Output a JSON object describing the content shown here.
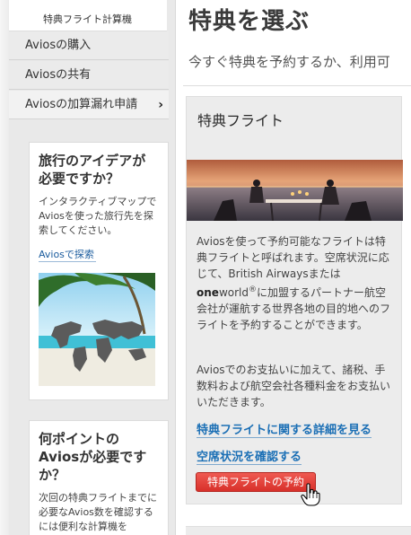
{
  "sidebar": {
    "sub_item": "特典フライト計算機",
    "items": [
      {
        "label": "Aviosの購入"
      },
      {
        "label": "Aviosの共有"
      },
      {
        "label": "Aviosの加算漏れ申請"
      }
    ]
  },
  "idea_box": {
    "title": "旅行のアイデアが必要ですか？",
    "body": "インタラクティブマップでAviosを使った旅行先を探索してください。",
    "link": "Aviosで探索"
  },
  "points_box": {
    "title": "何ポイントのAviosが必要ですか？",
    "body": "次回の特典フライトまでに必要なAvios数を確認するには便利な計算機を"
  },
  "main": {
    "title": "特典を選ぶ",
    "intro": "今すぐ特典を予約するか、利用可"
  },
  "card": {
    "title": "特典フライト",
    "para1_part1": "Aviosを使って予約可能なフライトは特典フライトと呼ばれます。空席状況に応じて、British Airwaysまたは",
    "para1_brand_one": "one",
    "para1_brand_world": "world",
    "para1_brand_reg": "®",
    "para1_part2": "に加盟するパートナー航空会社が運航する世界各地の目的地へのフライトを予約することができます。",
    "para2": "Aviosでのお支払いに加えて、諸税、手数料および航空会社各種料金をお支払いいただきます。",
    "link_details": "特典フライトに関する詳細を見る",
    "link_availability": "空席状況を確認する",
    "book_button": "特典フライトの予約"
  },
  "colors": {
    "link": "#1b6fb5",
    "button": "#e0403a",
    "card_bg": "#ececec"
  },
  "icons": [
    "chevron-right-icon",
    "hand-cursor-icon"
  ]
}
